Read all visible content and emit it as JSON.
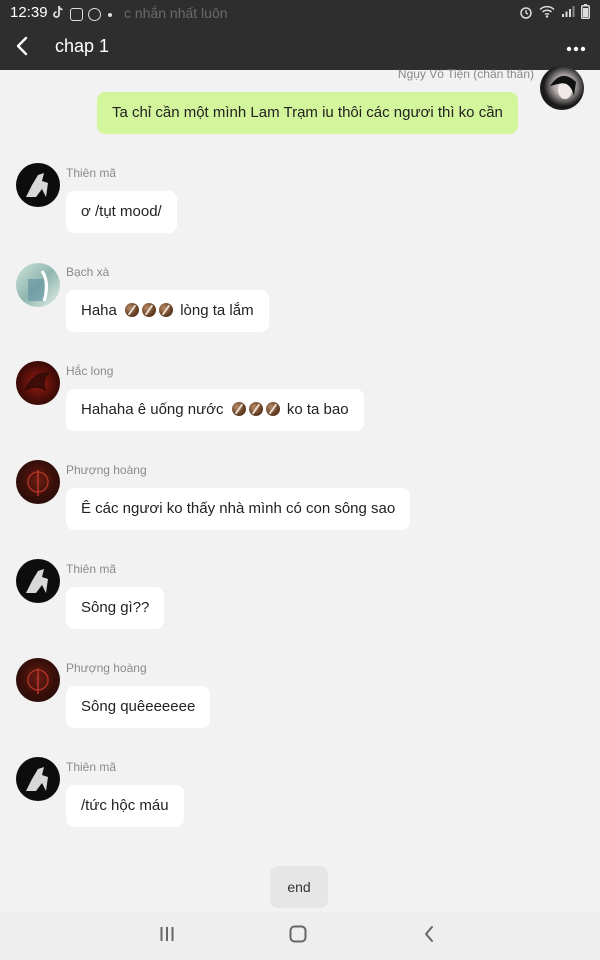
{
  "status_bar": {
    "time": "12:39",
    "ghost_text": "c nhắn nhất luôn",
    "left_icons": [
      "tiktok-icon",
      "youtube-icon",
      "minus-circle-icon",
      "dot-icon"
    ],
    "right_icons": [
      "alarm-icon",
      "wifi-icon",
      "signal-icon",
      "battery-icon"
    ]
  },
  "header": {
    "title": "chap 1",
    "back_icon": "chevron-left-icon",
    "more_icon": "more-dots-icon"
  },
  "messages": [
    {
      "sender": "Ngụy Vô Tiện (chân thân)",
      "text": "Ta chỉ cần một mình Lam Trạm iu thôi các ngươi thì ko cần",
      "mine": true
    },
    {
      "sender": "Thiên mã",
      "text": "ơ /tụt mood/"
    },
    {
      "sender": "Bạch xà",
      "text_before": "Haha",
      "emoji": [
        "coconut-emoji",
        "coconut-emoji",
        "coconut-emoji"
      ],
      "text_after": "lòng ta lắm"
    },
    {
      "sender": "Hắc long",
      "text_before": "Hahaha ê uống nước",
      "emoji": [
        "coconut-emoji",
        "coconut-emoji",
        "coconut-emoji"
      ],
      "text_after": "ko ta bao"
    },
    {
      "sender": "Phượng hoàng",
      "text": "Ê các ngươi ko thấy nhà mình có con sông sao"
    },
    {
      "sender": "Thiên mã",
      "text": "Sông gì??"
    },
    {
      "sender": "Phượng hoàng",
      "text": "Sông quêeeeeee"
    },
    {
      "sender": "Thiên mã",
      "text": "/tức hộc máu"
    }
  ],
  "end_label": "end",
  "nav_bar": [
    "recent-apps-icon",
    "home-icon",
    "back-icon"
  ],
  "colors": {
    "header_bg": "#2e2e2e",
    "page_bg": "#f2f2f2",
    "my_bubble": "#d3f59b",
    "other_bubble": "#ffffff"
  }
}
